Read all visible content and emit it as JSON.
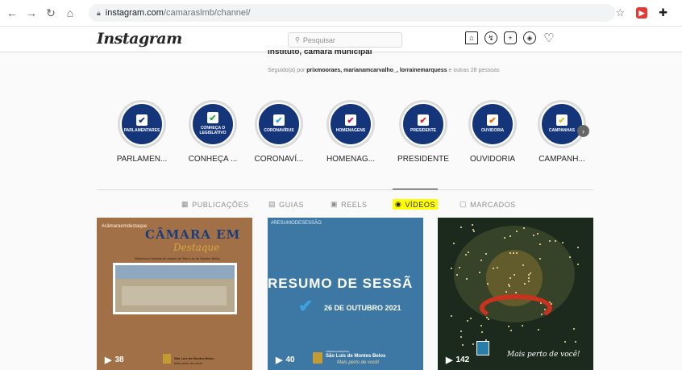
{
  "browser": {
    "url_host": "instagram.com",
    "url_path": "/camaraslmb/channel/"
  },
  "header": {
    "logo": "Instagram",
    "search_placeholder": "Pesquisar"
  },
  "profile": {
    "followed_prefix": "Seguido(a) por",
    "followed_users": "prixmooraes, marianamcarvalho_, lorrainemarquess",
    "followed_suffix": "e outras 28 pessoas"
  },
  "highlights": [
    {
      "label": "PARLAMEN...",
      "band": "PARLAMENTARES",
      "check_color": "#1c3d7a"
    },
    {
      "label": "CONHEÇA ...",
      "band": "CONHEÇA O LEGISLATIVO",
      "check_color": "#2fae3a"
    },
    {
      "label": "CORONAVÍ...",
      "band": "CORONAVÍRUS",
      "check_color": "#3aa2e0"
    },
    {
      "label": "HOMENAG...",
      "band": "HOMENAGENS",
      "check_color": "#c2185b"
    },
    {
      "label": "PRESIDENTE",
      "band": "PRESIDENTE",
      "check_color": "#d32f2f"
    },
    {
      "label": "OUVIDORIA",
      "band": "OUVIDORIA",
      "check_color": "#ef6c00"
    },
    {
      "label": "CAMPANH...",
      "band": "CAMPANHAS",
      "check_color": "#c0ca33"
    }
  ],
  "tabs": [
    {
      "label": "PUBLICAÇÕES",
      "icon": "grid-icon"
    },
    {
      "label": "GUIAS",
      "icon": "guide-icon"
    },
    {
      "label": "REELS",
      "icon": "reels-icon"
    },
    {
      "label": "VÍDEOS",
      "icon": "video-icon",
      "active": true
    },
    {
      "label": "MARCADOS",
      "icon": "tag-icon"
    }
  ],
  "videos": [
    {
      "views": "38",
      "tag": "#câmaraemdestaque",
      "title": "CÂMARA EM",
      "script": "Destaque",
      "subtitle": "Memória e história da origem de São Luís de Montes Belos",
      "footer": "São Luís de Montes Belos",
      "footer_italic": "Mais perto de você!"
    },
    {
      "views": "40",
      "tag": "#RESUMODESESSÃO",
      "title": "RESUMO DE SESSÃ",
      "date": "26 DE OUTUBRO 2021",
      "footer_small": "CÂMARA MUNICIPAL",
      "footer": "São Luís de Montes Belos",
      "footer_italic": "Mais perto de você!"
    },
    {
      "views": "142",
      "footer_italic": "Mais perto de você!"
    }
  ],
  "colors": {
    "highlight_blue": "#15357a",
    "active_tab_highlight": "#ffff00"
  }
}
